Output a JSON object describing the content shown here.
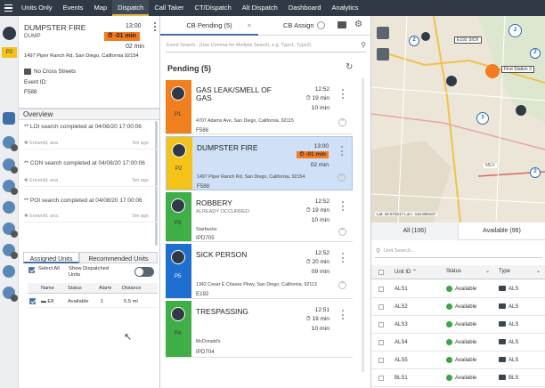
{
  "nav": {
    "items": [
      "Units Only",
      "Events",
      "Map",
      "Dispatch",
      "Call Taker",
      "CT/Dispatch",
      "Alt Dispatch",
      "Dashboard",
      "Analytics"
    ],
    "active_index": 3
  },
  "left": {
    "event": {
      "title": "DUMPSTER FIRE",
      "type": "DUMP",
      "time": "13:00",
      "overdue": "-01 min",
      "countdown": "02 min",
      "priority": "P2",
      "address": "1497 Piper Ranch Rd, San Diego, California 92154",
      "cross": "No Cross Streets",
      "event_id_label": "Event ID:",
      "event_id": "F588"
    },
    "overview_label": "Overview",
    "log": [
      {
        "text": "** LOI search completed at 04/08/20 17:00:06",
        "user": "Erewold, ana",
        "ago": "5m ago"
      },
      {
        "text": "** CON search completed at 04/08/20 17:00:06",
        "user": "Erewold, ana",
        "ago": "5m ago"
      },
      {
        "text": "** POI search completed at 04/08/20 17:00:06",
        "user": "Erewold, ana",
        "ago": "5m ago"
      }
    ],
    "tabs": {
      "assigned": "Assigned Units",
      "recommended": "Recommended Units"
    },
    "select_all": "Select All",
    "show_dispatched": "Show Dispatched Units",
    "table": {
      "headers": [
        "Name",
        "Status",
        "Alarm",
        "Distance"
      ],
      "rows": [
        {
          "name": "E8",
          "status": "Available",
          "alarm": "1",
          "distance": "5.5 mi"
        }
      ]
    }
  },
  "mid": {
    "tabs": [
      {
        "label": "CB Pending (5)"
      },
      {
        "label": "CB Assign"
      }
    ],
    "search_placeholder": "Event Search...(Use Comma for Multiple Search, e.g. Type1, Type2)",
    "pending_label": "Pending (5)",
    "cards": [
      {
        "title": "GAS LEAK/SMELL OF GAS",
        "time": "12:52",
        "due": "19 min",
        "countdown": "10 min",
        "priority": "P1",
        "address": "4707 Adams Ave, San Diego, California, 92115",
        "id": "F586",
        "color": "#f07f1e"
      },
      {
        "title": "DUMPSTER FIRE",
        "time": "13:00",
        "overdue": "-01 min",
        "countdown": "02 min",
        "priority": "P2",
        "address": "1497 Piper Ranch Rd, San Diego, California, 92154",
        "id": "F588",
        "color": "#f3c31a"
      },
      {
        "title": "ROBBERY",
        "subtitle": "ALREADY OCCURRED",
        "time": "12:52",
        "due": "19 min",
        "countdown": "10 min",
        "priority": "P3",
        "location": "Starbucks",
        "id": "IPD705",
        "color": "#3fae47"
      },
      {
        "title": "SICK PERSON",
        "time": "12:52",
        "due": "20 min",
        "countdown": "09 min",
        "priority": "P5",
        "address": "1342 Cesar E Chavez Pkwy, San Diego, California, 92113",
        "id": "E192",
        "color": "#1e6fd0"
      },
      {
        "title": "TRESPASSING",
        "time": "12:51",
        "due": "19 min",
        "countdown": "10 min",
        "priority": "P4",
        "location": "McDonald's",
        "id": "IPD704",
        "color": "#3fae47"
      }
    ]
  },
  "right": {
    "map": {
      "coords": "Lat: 32.573217 Lon: -116.869167",
      "labels": [
        "E192 SICK",
        "First Station 3",
        "MEX"
      ],
      "pins": [
        "2",
        "2",
        "3",
        "2",
        "2"
      ]
    },
    "unit_tabs": {
      "all": "All (106)",
      "available": "Available (96)"
    },
    "unit_search_placeholder": "Unit Search...",
    "headers": [
      "Unit ID",
      "Status",
      "Type"
    ],
    "units": [
      {
        "id": "ALS1",
        "status": "Available",
        "type": "ALS"
      },
      {
        "id": "ALS2",
        "status": "Available",
        "type": "ALS"
      },
      {
        "id": "ALS3",
        "status": "Available",
        "type": "ALS"
      },
      {
        "id": "ALS4",
        "status": "Available",
        "type": "ALS"
      },
      {
        "id": "ALS5",
        "status": "Available",
        "type": "ALS"
      },
      {
        "id": "BLS1",
        "status": "Available",
        "type": "BLS"
      }
    ]
  },
  "colors": {
    "nav_bg": "#2f3a46",
    "accent": "#e8b84a",
    "overdue": "#f47b20",
    "selected_card": "#cfe0f7",
    "available": "#3aa646"
  }
}
